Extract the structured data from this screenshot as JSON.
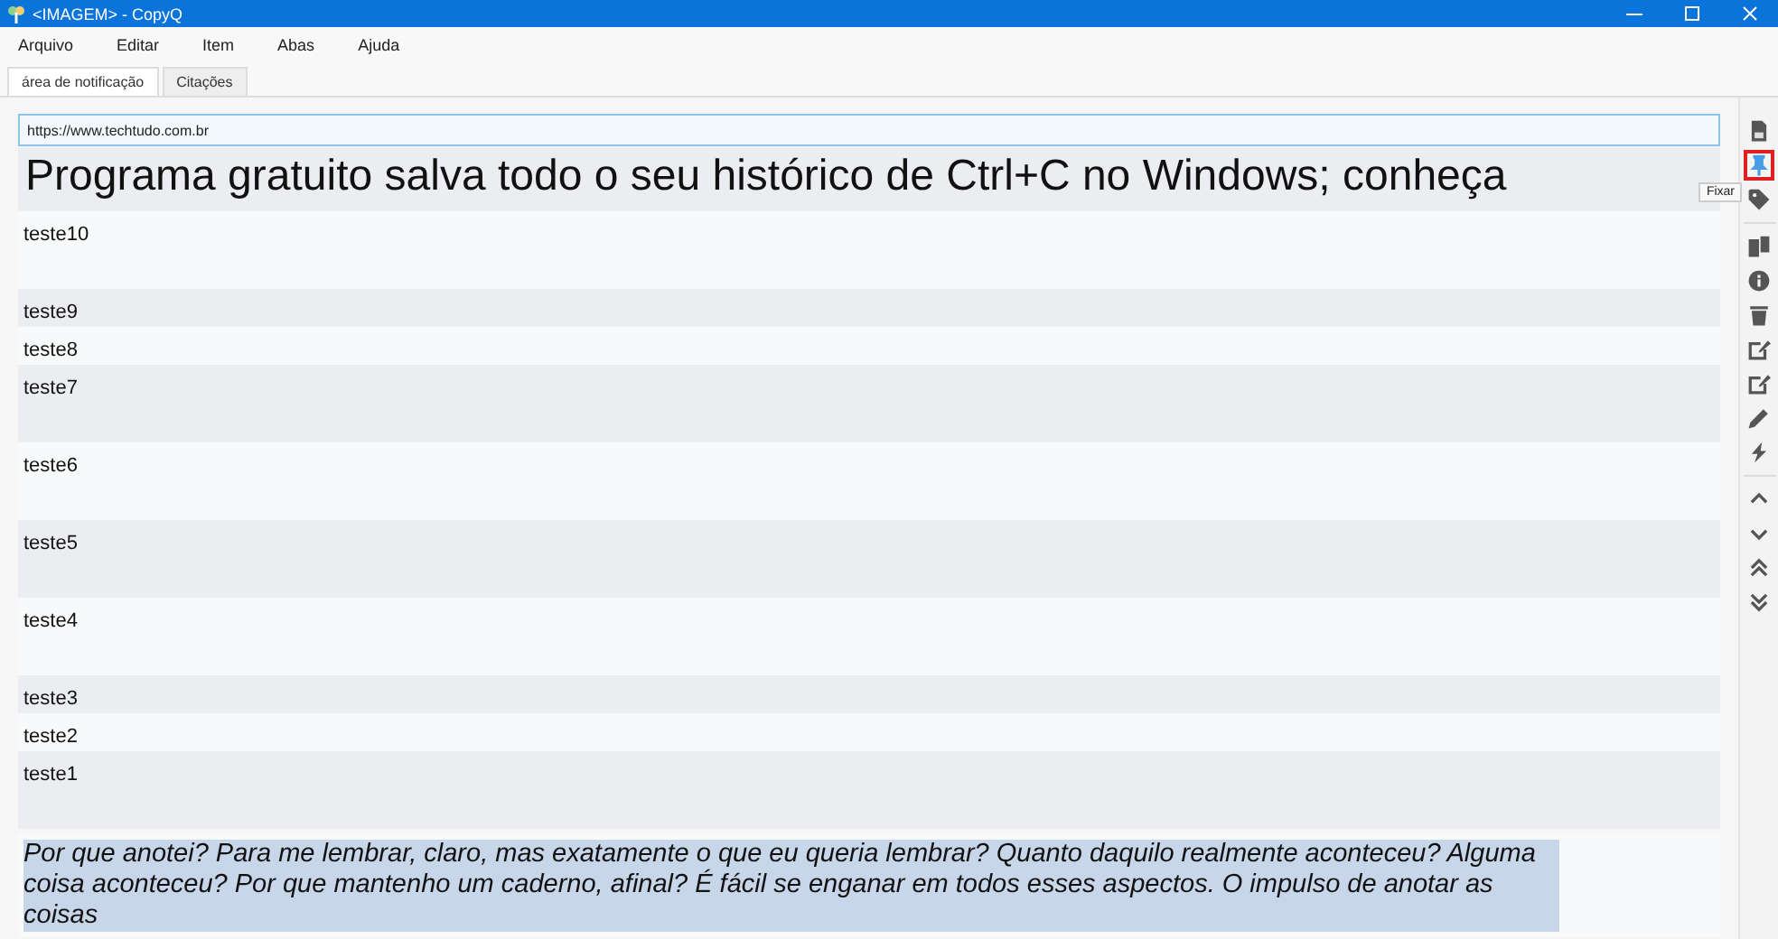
{
  "window": {
    "title": "<IMAGEM> - CopyQ"
  },
  "menu": [
    "Arquivo",
    "Editar",
    "Item",
    "Abas",
    "Ajuda"
  ],
  "tabs": [
    {
      "label": "área de notificação",
      "selected": true
    },
    {
      "label": "Citações",
      "selected": false
    }
  ],
  "editor": {
    "value": "https://www.techtudo.com.br"
  },
  "items": [
    {
      "kind": "heading",
      "text": "Programa gratuito salva todo o seu histórico de Ctrl+C no Windows; conheça"
    },
    {
      "kind": "tall",
      "text": "teste10"
    },
    {
      "kind": "short",
      "text": "teste9"
    },
    {
      "kind": "short",
      "text": "teste8"
    },
    {
      "kind": "tall",
      "text": "teste7"
    },
    {
      "kind": "tall",
      "text": "teste6"
    },
    {
      "kind": "tall",
      "text": "teste5"
    },
    {
      "kind": "tall",
      "text": "teste4"
    },
    {
      "kind": "short",
      "text": "teste3"
    },
    {
      "kind": "short",
      "text": "teste2"
    },
    {
      "kind": "tall",
      "text": "teste1"
    },
    {
      "kind": "quote",
      "text": "Por que anotei? Para me lembrar, claro, mas exatamente o que eu queria lembrar? Quanto daquilo realmente aconteceu? Alguma coisa aconteceu? Por que mantenho um caderno, afinal? É fácil se enganar em todos esses aspectos. O impulso de anotar as coisas"
    }
  ],
  "toolbar": [
    {
      "kind": "file",
      "highlighted": false
    },
    {
      "kind": "pin",
      "highlighted": true,
      "tooltip": "Fixar"
    },
    {
      "kind": "tag",
      "highlighted": false
    },
    {
      "kind": "sep"
    },
    {
      "kind": "copy",
      "highlighted": false
    },
    {
      "kind": "info",
      "highlighted": false
    },
    {
      "kind": "trash",
      "highlighted": false
    },
    {
      "kind": "edit",
      "highlighted": false
    },
    {
      "kind": "edit",
      "highlighted": false
    },
    {
      "kind": "pencil",
      "highlighted": false
    },
    {
      "kind": "bolt",
      "highlighted": false
    },
    {
      "kind": "sep"
    },
    {
      "kind": "up",
      "highlighted": false
    },
    {
      "kind": "down",
      "highlighted": false
    },
    {
      "kind": "top",
      "highlighted": false
    },
    {
      "kind": "bottom",
      "highlighted": false
    }
  ]
}
